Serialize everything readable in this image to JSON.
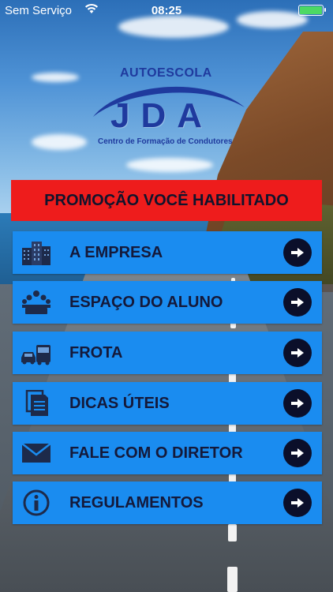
{
  "status_bar": {
    "carrier": "Sem Serviço",
    "time": "08:25",
    "battery_color": "#4cd964"
  },
  "logo": {
    "top_text": "AUTOESCOLA",
    "main_text": "JDA",
    "subtitle": "Centro de Formação de Condutores",
    "color": "#1f3a9e"
  },
  "promo": {
    "label": "PROMOÇÃO VOCÊ HABILITADO",
    "bg_color": "#ee1c1c"
  },
  "menu": {
    "button_color": "#1a8cf0",
    "items": [
      {
        "label": "A EMPRESA",
        "icon": "buildings-icon"
      },
      {
        "label": "ESPAÇO DO ALUNO",
        "icon": "students-icon"
      },
      {
        "label": "FROTA",
        "icon": "vehicles-icon"
      },
      {
        "label": "DICAS ÚTEIS",
        "icon": "documents-icon"
      },
      {
        "label": "FALE COM O DIRETOR",
        "icon": "envelope-icon"
      },
      {
        "label": "REGULAMENTOS",
        "icon": "info-icon"
      }
    ],
    "arrow_icon": "arrow-right-circle-icon"
  }
}
